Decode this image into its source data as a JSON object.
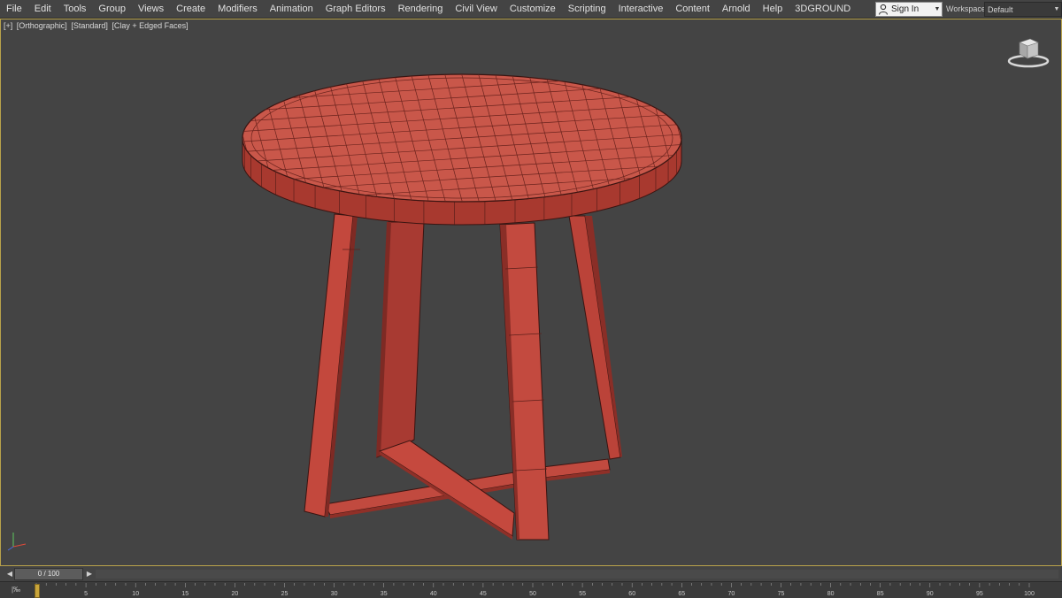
{
  "menu": {
    "items": [
      "File",
      "Edit",
      "Tools",
      "Group",
      "Views",
      "Create",
      "Modifiers",
      "Animation",
      "Graph Editors",
      "Rendering",
      "Civil View",
      "Customize",
      "Scripting",
      "Interactive",
      "Content",
      "Arnold",
      "Help",
      "3DGROUND"
    ]
  },
  "account": {
    "signin_label": "Sign In",
    "user_icon": "user-icon",
    "dropdown_icon": "chevron-down-icon"
  },
  "workspace": {
    "label": "Workspaces:",
    "value": "Default"
  },
  "viewport": {
    "label_plus": "[+]",
    "label_view": "[Orthographic]",
    "label_shading": "[Standard]",
    "label_style": "[Clay + Edged Faces]",
    "model_color": "#c0473d",
    "border_color": "#b9a24a",
    "background": "#444444"
  },
  "timeslider": {
    "frame_display": "0 / 100",
    "prev_icon": "chevron-left-icon",
    "next_icon": "chevron-right-icon"
  },
  "trackbar": {
    "icon_label": "|‰",
    "ticks": [
      0,
      5,
      10,
      15,
      20,
      25,
      30,
      35,
      40,
      45,
      50,
      55,
      60,
      65,
      70,
      75,
      80,
      85,
      90,
      95,
      100
    ],
    "current_frame": 0
  }
}
